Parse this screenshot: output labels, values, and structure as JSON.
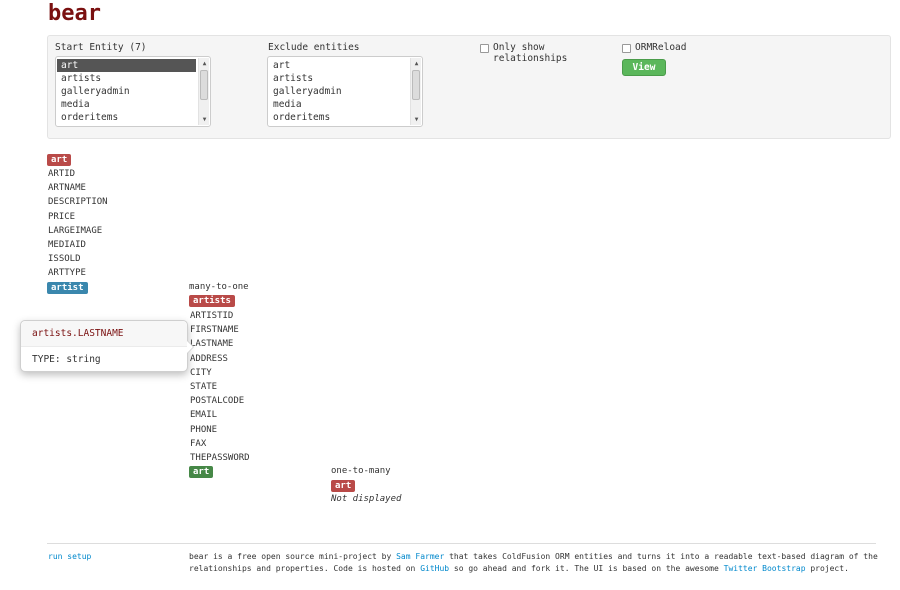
{
  "brand": "bear",
  "filters": {
    "start_entity_label": "Start Entity (7)",
    "start_entity_options": [
      "art",
      "artists",
      "galleryadmin",
      "media",
      "orderitems"
    ],
    "start_entity_selected": "art",
    "exclude_label": "Exclude entities",
    "exclude_options": [
      "art",
      "artists",
      "galleryadmin",
      "media",
      "orderitems"
    ],
    "only_relationships_label": "Only show relationships",
    "only_relationships_checked": false,
    "orm_reload_label": "ORMReload",
    "orm_reload_checked": false,
    "view_button": "View"
  },
  "diagram": {
    "root": {
      "entity": "art",
      "properties": [
        "ARTID",
        "ARTNAME",
        "DESCRIPTION",
        "PRICE",
        "LARGEIMAGE",
        "MEDIAID",
        "ISSOLD",
        "ARTTYPE"
      ],
      "relation_label": "artist"
    },
    "level2": {
      "relation_type": "many-to-one",
      "entity": "artists",
      "properties": [
        "ARTISTID",
        "FIRSTNAME",
        "LASTNAME",
        "ADDRESS",
        "CITY",
        "STATE",
        "POSTALCODE",
        "EMAIL",
        "PHONE",
        "FAX",
        "THEPASSWORD"
      ],
      "relation_label": "art"
    },
    "level3": {
      "relation_type": "one-to-many",
      "entity": "art",
      "note": "Not displayed"
    }
  },
  "popover": {
    "title": "artists.LASTNAME",
    "content": "TYPE: string"
  },
  "footer": {
    "run_setup": "run setup",
    "text_1": "bear is a free open source mini-project by ",
    "link_author": "Sam Farmer",
    "text_2": " that takes ColdFusion ORM entities and turns it into a readable text-based diagram of the relationships and properties. Code is hosted on ",
    "link_github": "GitHub",
    "text_3": " so go ahead and fork it. The UI is based on the awesome ",
    "link_bootstrap": "Twitter Bootstrap",
    "text_4": " project."
  },
  "colors": {
    "brand": "#7a1010",
    "entity_label": "#b94a48",
    "relation_label_blue": "#3a87ad",
    "relation_label_green": "#468847",
    "button": "#5bb75b",
    "link": "#0088cc"
  }
}
